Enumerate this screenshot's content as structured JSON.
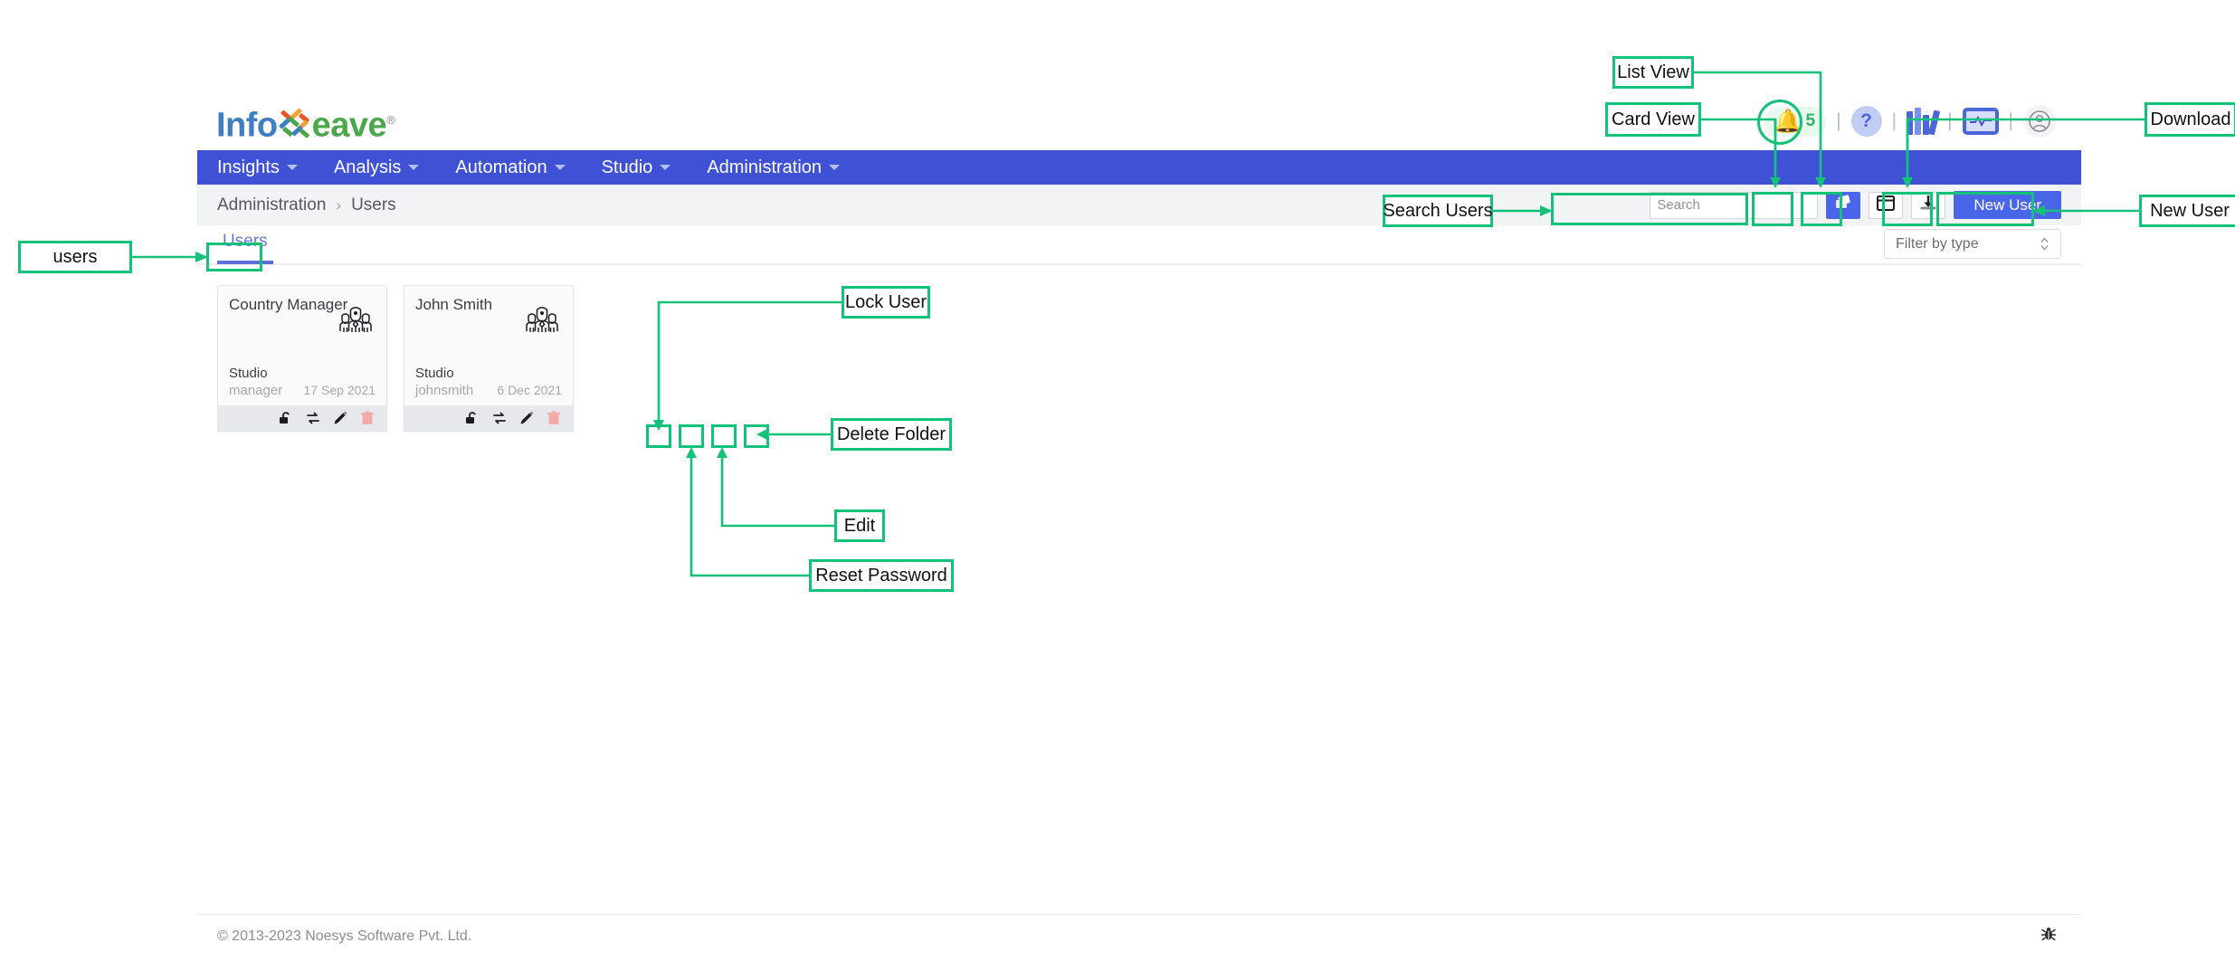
{
  "brand": {
    "name_part1": "Info",
    "name_part2": "eave",
    "registered": "®",
    "logo_mark": "woven-squares-logo"
  },
  "topbar": {
    "notification_count": "5",
    "help_label": "?",
    "icons": [
      "bell-icon",
      "help-icon",
      "books-icon",
      "monitor-icon",
      "account-icon"
    ],
    "separator": "|"
  },
  "mainnav": {
    "items": [
      {
        "label": "Insights"
      },
      {
        "label": "Analysis"
      },
      {
        "label": "Automation"
      },
      {
        "label": "Studio"
      },
      {
        "label": "Administration"
      }
    ]
  },
  "breadcrumb": {
    "root": "Administration",
    "separator": "›",
    "current": "Users"
  },
  "search": {
    "placeholder": "Search",
    "value": ""
  },
  "actions": {
    "card_view_icon": "cards-icon",
    "list_view_icon": "list-layout-icon",
    "download_icon": "download-icon",
    "new_user_label": "New User"
  },
  "tabs": [
    {
      "label": "Users",
      "active": true
    }
  ],
  "filter": {
    "label": "Filter by type"
  },
  "cards": [
    {
      "title": "Country Manager",
      "app": "Studio",
      "username": "manager",
      "date": "17 Sep 2021",
      "actions": [
        "lock-icon",
        "reset-password-icon",
        "edit-icon",
        "delete-icon"
      ]
    },
    {
      "title": "John Smith",
      "app": "Studio",
      "username": "johnsmith",
      "date": "6 Dec 2021",
      "actions": [
        "lock-icon",
        "reset-password-icon",
        "edit-icon",
        "delete-icon"
      ]
    }
  ],
  "footer": {
    "copyright": "© 2013-2023 Noesys Software Pvt. Ltd.",
    "debug_icon": "bug-icon"
  },
  "annotations": {
    "users": "users",
    "list_view": "List View",
    "card_view": "Card View",
    "download": "Download",
    "search_users": "Search  Users",
    "new_user": "New User",
    "lock_user": "Lock User",
    "delete_folder": "Delete Folder",
    "edit": "Edit",
    "reset_password": "Reset Password"
  },
  "colors": {
    "brand_blue": "#3f51d4",
    "accent_blue": "#4a66e8",
    "annotation_green": "#14c178",
    "nav_text": "#ffffff",
    "delete_red": "#f6a9a9"
  }
}
